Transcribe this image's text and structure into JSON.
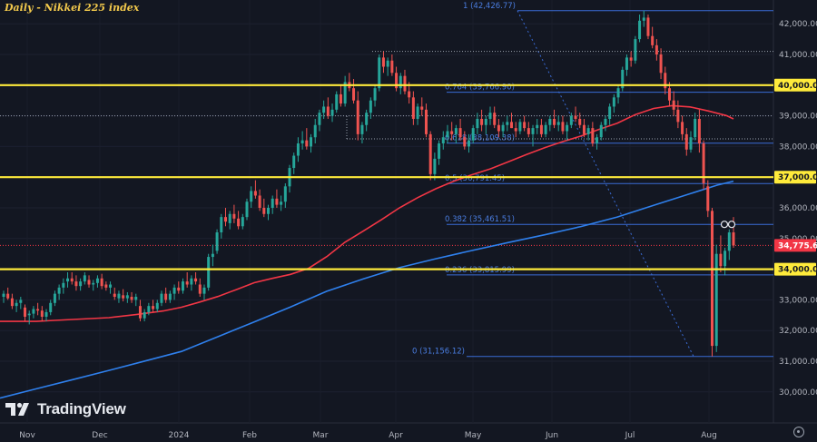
{
  "title": "Daily - Nikkei 225 index",
  "brand": "TradingView",
  "price_label": "34,775.64",
  "chart_data": {
    "type": "candlestick",
    "ylim": [
      29400,
      42700
    ],
    "y_ticks": [
      {
        "v": 30000,
        "t": "30,000.00"
      },
      {
        "v": 31000,
        "t": "31,000.00"
      },
      {
        "v": 32000,
        "t": "32,000.00"
      },
      {
        "v": 33000,
        "t": "33,000.00"
      },
      {
        "v": 34000,
        "t": "34,000.00"
      },
      {
        "v": 35000,
        "t": "35,000.00"
      },
      {
        "v": 36000,
        "t": "36,000.00"
      },
      {
        "v": 37000,
        "t": "37,000.00"
      },
      {
        "v": 38000,
        "t": "38,000.00"
      },
      {
        "v": 39000,
        "t": "39,000.00"
      },
      {
        "v": 40000,
        "t": "40,000.00"
      },
      {
        "v": 41000,
        "t": "41,000.00"
      },
      {
        "v": 42000,
        "t": "42,000.00"
      }
    ],
    "x_ticks": [
      "Nov",
      "Dec",
      "2024",
      "Feb",
      "Mar",
      "Apr",
      "May",
      "Jun",
      "Jul",
      "Aug"
    ],
    "key_levels": [
      {
        "v": 40000,
        "t": "40,000.00"
      },
      {
        "v": 37000,
        "t": "37,000.00"
      },
      {
        "v": 34000,
        "t": "34,000.00"
      }
    ],
    "current_price": 34775.64,
    "fib_levels": [
      {
        "ratio": "1",
        "v": 42426.77,
        "text": "1 (42,426.77)"
      },
      {
        "ratio": "0.764",
        "v": 39766.9,
        "text": "0.764 (39,766.90)"
      },
      {
        "ratio": "0.618",
        "v": 38109.38,
        "text": "0.618 (38,109.38)"
      },
      {
        "ratio": "0.5",
        "v": 36791.45,
        "text": "0.5 (36,791.45)"
      },
      {
        "ratio": "0.382",
        "v": 35461.51,
        "text": "0.382 (35,461.51)"
      },
      {
        "ratio": "0.236",
        "v": 33815.99,
        "text": "0.236 (33,815.99)"
      },
      {
        "ratio": "0",
        "v": 31156.12,
        "text": "0 (31,156.12)"
      }
    ],
    "series": [
      {
        "kind": "100-day moving average (red)",
        "values": [
          [
            0,
            32300
          ],
          [
            20,
            32300
          ],
          [
            40,
            32300
          ],
          [
            60,
            32330
          ],
          [
            80,
            32360
          ],
          [
            100,
            32390
          ],
          [
            120,
            32420
          ],
          [
            150,
            32520
          ],
          [
            180,
            32640
          ],
          [
            200,
            32760
          ],
          [
            220,
            32930
          ],
          [
            240,
            33110
          ],
          [
            260,
            33330
          ],
          [
            280,
            33560
          ],
          [
            300,
            33700
          ],
          [
            320,
            33830
          ],
          [
            340,
            34030
          ],
          [
            360,
            34410
          ],
          [
            380,
            34880
          ],
          [
            400,
            35240
          ],
          [
            420,
            35610
          ],
          [
            440,
            36000
          ],
          [
            460,
            36330
          ],
          [
            480,
            36620
          ],
          [
            500,
            36870
          ],
          [
            520,
            37080
          ],
          [
            540,
            37270
          ],
          [
            560,
            37500
          ],
          [
            580,
            37740
          ],
          [
            600,
            37960
          ],
          [
            620,
            38160
          ],
          [
            640,
            38340
          ],
          [
            660,
            38560
          ],
          [
            680,
            38760
          ],
          [
            700,
            39040
          ],
          [
            720,
            39240
          ],
          [
            740,
            39330
          ],
          [
            760,
            39290
          ],
          [
            780,
            39160
          ],
          [
            800,
            39010
          ],
          [
            808,
            38900
          ]
        ]
      },
      {
        "kind": "200-day moving average (blue)",
        "values": [
          [
            0,
            29800
          ],
          [
            40,
            30100
          ],
          [
            80,
            30400
          ],
          [
            120,
            30700
          ],
          [
            160,
            31010
          ],
          [
            200,
            31320
          ],
          [
            240,
            31800
          ],
          [
            280,
            32280
          ],
          [
            320,
            32770
          ],
          [
            360,
            33280
          ],
          [
            400,
            33680
          ],
          [
            440,
            34050
          ],
          [
            480,
            34340
          ],
          [
            520,
            34610
          ],
          [
            560,
            34870
          ],
          [
            600,
            35120
          ],
          [
            640,
            35390
          ],
          [
            680,
            35700
          ],
          [
            720,
            36080
          ],
          [
            760,
            36460
          ],
          [
            790,
            36740
          ],
          [
            808,
            36870
          ]
        ]
      }
    ],
    "candles": [
      [
        33100,
        33300,
        32900,
        33200
      ],
      [
        33200,
        33400,
        33000,
        33050
      ],
      [
        33050,
        33200,
        32700,
        32800
      ],
      [
        32800,
        33000,
        32600,
        32900
      ],
      [
        32900,
        33100,
        32700,
        33000
      ],
      [
        32750,
        32850,
        32300,
        32450
      ],
      [
        32500,
        32650,
        32200,
        32550
      ],
      [
        32550,
        32800,
        32400,
        32700
      ],
      [
        32700,
        32900,
        32500,
        32650
      ],
      [
        32650,
        32800,
        32300,
        32450
      ],
      [
        32450,
        32700,
        32300,
        32600
      ],
      [
        32600,
        33000,
        32500,
        32900
      ],
      [
        32900,
        33300,
        32800,
        33200
      ],
      [
        33200,
        33500,
        33000,
        33400
      ],
      [
        33400,
        33700,
        33200,
        33550
      ],
      [
        33600,
        33900,
        33400,
        33700
      ],
      [
        33700,
        33900,
        33500,
        33600
      ],
      [
        33600,
        33800,
        33300,
        33450
      ],
      [
        33450,
        33700,
        33300,
        33600
      ],
      [
        33600,
        33900,
        33500,
        33800
      ],
      [
        33650,
        33800,
        33400,
        33500
      ],
      [
        33500,
        33650,
        33300,
        33550
      ],
      [
        33550,
        33800,
        33400,
        33700
      ],
      [
        33700,
        33850,
        33350,
        33450
      ],
      [
        33500,
        33600,
        33300,
        33400
      ],
      [
        33400,
        33600,
        33200,
        33500
      ],
      [
        33200,
        33400,
        33000,
        33100
      ],
      [
        33050,
        33300,
        32900,
        33200
      ],
      [
        33150,
        33350,
        32950,
        33050
      ],
      [
        33050,
        33250,
        32900,
        33150
      ],
      [
        33100,
        33250,
        32900,
        33000
      ],
      [
        33000,
        33200,
        32800,
        33100
      ],
      [
        32800,
        33000,
        32300,
        32400
      ],
      [
        32400,
        32700,
        32300,
        32600
      ],
      [
        32600,
        32900,
        32500,
        32800
      ],
      [
        32800,
        33000,
        32600,
        32700
      ],
      [
        32700,
        33000,
        32600,
        32900
      ],
      [
        32900,
        33300,
        32800,
        33200
      ],
      [
        33200,
        33400,
        32900,
        33000
      ],
      [
        33000,
        33300,
        32900,
        33200
      ],
      [
        33200,
        33500,
        33000,
        33400
      ],
      [
        33400,
        33600,
        33200,
        33300
      ],
      [
        33300,
        33700,
        33200,
        33600
      ],
      [
        33600,
        33900,
        33400,
        33500
      ],
      [
        33500,
        33800,
        33300,
        33700
      ],
      [
        33700,
        33900,
        33500,
        33600
      ],
      [
        33500,
        33700,
        33100,
        33200
      ],
      [
        33200,
        33500,
        33000,
        33400
      ],
      [
        33400,
        34500,
        33300,
        34400
      ],
      [
        34400,
        34800,
        34100,
        34500
      ],
      [
        34600,
        35300,
        34500,
        35200
      ],
      [
        35200,
        35800,
        35000,
        35700
      ],
      [
        35700,
        36000,
        35400,
        35550
      ],
      [
        35500,
        35900,
        35300,
        35800
      ],
      [
        35800,
        36100,
        35500,
        35650
      ],
      [
        35650,
        35900,
        35300,
        35400
      ],
      [
        35400,
        35800,
        35300,
        35700
      ],
      [
        35700,
        36300,
        35600,
        36200
      ],
      [
        36200,
        36700,
        36000,
        36550
      ],
      [
        36550,
        36900,
        36300,
        36400
      ],
      [
        36400,
        36600,
        35900,
        36000
      ],
      [
        36000,
        36300,
        35700,
        35800
      ],
      [
        35800,
        36100,
        35600,
        36000
      ],
      [
        36000,
        36400,
        35800,
        36300
      ],
      [
        36300,
        36600,
        36000,
        36100
      ],
      [
        36100,
        36400,
        35900,
        36200
      ],
      [
        36200,
        36800,
        36000,
        36700
      ],
      [
        36700,
        37400,
        36500,
        37300
      ],
      [
        37300,
        37800,
        37100,
        37700
      ],
      [
        37700,
        38300,
        37500,
        38100
      ],
      [
        38100,
        38500,
        37900,
        38200
      ],
      [
        38200,
        38600,
        37900,
        38000
      ],
      [
        38000,
        38400,
        37800,
        38300
      ],
      [
        38300,
        38900,
        38100,
        38700
      ],
      [
        38700,
        39200,
        38500,
        39100
      ],
      [
        39100,
        39500,
        38900,
        39300
      ],
      [
        39300,
        39600,
        38900,
        39000
      ],
      [
        39000,
        39400,
        38800,
        39200
      ],
      [
        39200,
        39800,
        39100,
        39700
      ],
      [
        39700,
        40000,
        39300,
        39400
      ],
      [
        39400,
        40300,
        39300,
        40100
      ],
      [
        40100,
        40400,
        39800,
        39900
      ],
      [
        39900,
        40200,
        39400,
        39500
      ],
      [
        39500,
        39800,
        38200,
        38400
      ],
      [
        38400,
        38800,
        38100,
        38700
      ],
      [
        38700,
        39200,
        38500,
        39100
      ],
      [
        39100,
        39600,
        38900,
        39500
      ],
      [
        39500,
        40000,
        39300,
        39900
      ],
      [
        39900,
        41000,
        39800,
        40900
      ],
      [
        40900,
        41100,
        40400,
        40600
      ],
      [
        40600,
        40900,
        40300,
        40800
      ],
      [
        40800,
        41000,
        40300,
        40400
      ],
      [
        40400,
        40600,
        39800,
        39900
      ],
      [
        39900,
        40400,
        39700,
        40300
      ],
      [
        40300,
        40500,
        39700,
        39800
      ],
      [
        39800,
        40100,
        39400,
        39600
      ],
      [
        39600,
        39800,
        38700,
        38900
      ],
      [
        38900,
        39400,
        38700,
        39300
      ],
      [
        39300,
        39600,
        39000,
        39200
      ],
      [
        39200,
        39400,
        38300,
        38400
      ],
      [
        38400,
        38500,
        36900,
        37100
      ],
      [
        37100,
        37800,
        36900,
        37600
      ],
      [
        37600,
        38200,
        37400,
        38100
      ],
      [
        38100,
        38500,
        37900,
        38300
      ],
      [
        38300,
        38700,
        38100,
        38500
      ],
      [
        38500,
        38800,
        38200,
        38400
      ],
      [
        38400,
        38700,
        38100,
        38600
      ],
      [
        38600,
        38900,
        38200,
        38300
      ],
      [
        38300,
        38500,
        37900,
        38000
      ],
      [
        38000,
        38400,
        37800,
        38200
      ],
      [
        38200,
        38700,
        38100,
        38600
      ],
      [
        38600,
        39100,
        38400,
        38900
      ],
      [
        38900,
        39200,
        38500,
        38700
      ],
      [
        38700,
        39000,
        38400,
        38900
      ],
      [
        38900,
        39300,
        38700,
        39100
      ],
      [
        39100,
        39300,
        38600,
        38700
      ],
      [
        38700,
        38900,
        38300,
        38500
      ],
      [
        38500,
        38800,
        38300,
        38700
      ],
      [
        38700,
        39000,
        38500,
        38800
      ],
      [
        38800,
        39100,
        38600,
        38600
      ],
      [
        38600,
        38800,
        38300,
        38500
      ],
      [
        38500,
        38900,
        38400,
        38800
      ],
      [
        38800,
        39000,
        38500,
        38600
      ],
      [
        38600,
        38800,
        38300,
        38400
      ],
      [
        38400,
        38700,
        38000,
        38600
      ],
      [
        38600,
        38900,
        38400,
        38700
      ],
      [
        38700,
        38900,
        38300,
        38400
      ],
      [
        38400,
        38800,
        38300,
        38700
      ],
      [
        38700,
        39000,
        38500,
        38900
      ],
      [
        38900,
        39200,
        38600,
        38700
      ],
      [
        38700,
        39000,
        38500,
        38800
      ],
      [
        38800,
        39000,
        38400,
        38500
      ],
      [
        38500,
        38800,
        38200,
        38700
      ],
      [
        38700,
        39100,
        38600,
        39000
      ],
      [
        39000,
        39300,
        38800,
        38900
      ],
      [
        38900,
        39100,
        38600,
        38700
      ],
      [
        38700,
        38900,
        38300,
        38400
      ],
      [
        38400,
        38700,
        38200,
        38600
      ],
      [
        38600,
        38800,
        38000,
        38100
      ],
      [
        38100,
        38400,
        37900,
        38300
      ],
      [
        38300,
        38800,
        38200,
        38700
      ],
      [
        38700,
        39000,
        38500,
        38900
      ],
      [
        38900,
        39400,
        38700,
        39300
      ],
      [
        39300,
        39700,
        39100,
        39600
      ],
      [
        39600,
        40000,
        39400,
        39900
      ],
      [
        39900,
        40600,
        39800,
        40500
      ],
      [
        40500,
        41000,
        40300,
        40900
      ],
      [
        40900,
        41100,
        40600,
        40800
      ],
      [
        40800,
        41600,
        40700,
        41500
      ],
      [
        41500,
        42300,
        41400,
        42100
      ],
      [
        42100,
        42426,
        41900,
        42200
      ],
      [
        42200,
        42300,
        41500,
        41600
      ],
      [
        41600,
        41900,
        41200,
        41300
      ],
      [
        41300,
        41500,
        40800,
        41000
      ],
      [
        41000,
        41200,
        40200,
        40400
      ],
      [
        40400,
        40600,
        39700,
        39900
      ],
      [
        39900,
        40100,
        39300,
        39500
      ],
      [
        39500,
        39800,
        39000,
        39200
      ],
      [
        39200,
        39500,
        38600,
        38800
      ],
      [
        38800,
        39000,
        38200,
        38400
      ],
      [
        38400,
        38600,
        37700,
        37900
      ],
      [
        37900,
        38500,
        37800,
        38300
      ],
      [
        38300,
        39100,
        38200,
        38900
      ],
      [
        38900,
        39200,
        37800,
        38100
      ],
      [
        38100,
        38200,
        36600,
        36800
      ],
      [
        36700,
        36900,
        35700,
        35900
      ],
      [
        35900,
        36000,
        31156,
        31500
      ],
      [
        31500,
        34800,
        31300,
        34500
      ],
      [
        34500,
        35100,
        33900,
        34100
      ],
      [
        34100,
        34700,
        33800,
        34600
      ],
      [
        34600,
        35300,
        34300,
        35200
      ],
      [
        35200,
        35700,
        34700,
        34776
      ]
    ]
  }
}
